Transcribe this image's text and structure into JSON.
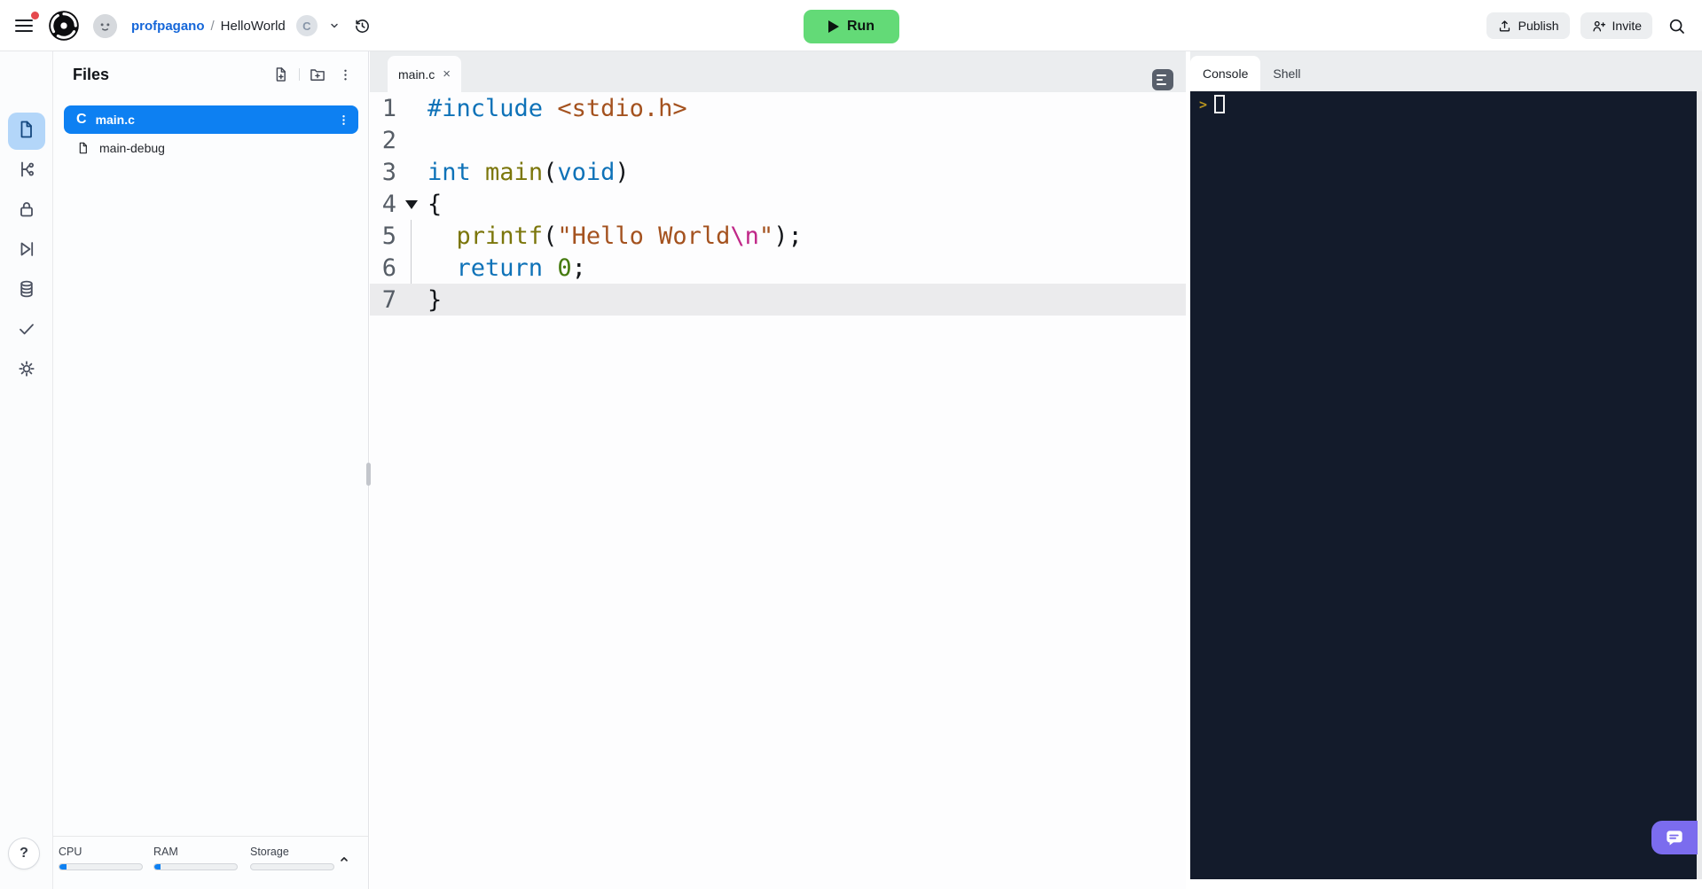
{
  "topbar": {
    "breadcrumb": {
      "user": "profpagano",
      "separator": "/",
      "project": "HelloWorld",
      "language_badge": "C"
    },
    "run_label": "Run",
    "publish_label": "Publish",
    "invite_label": "Invite"
  },
  "rail": {
    "items": [
      {
        "name": "files",
        "icon": "files-icon",
        "selected": true
      },
      {
        "name": "version-control",
        "icon": "branch-icon",
        "selected": false
      },
      {
        "name": "secrets",
        "icon": "lock-icon",
        "selected": false
      },
      {
        "name": "workflows",
        "icon": "runner-icon",
        "selected": false
      },
      {
        "name": "database",
        "icon": "database-icon",
        "selected": false
      },
      {
        "name": "checks",
        "icon": "check-icon",
        "selected": false
      },
      {
        "name": "settings",
        "icon": "gear-icon",
        "selected": false
      }
    ],
    "help_label": "?"
  },
  "files": {
    "title": "Files",
    "items": [
      {
        "name": "main.c",
        "type": "c",
        "selected": true
      },
      {
        "name": "main-debug",
        "type": "file",
        "selected": false
      }
    ]
  },
  "editor": {
    "tab": {
      "label": "main.c",
      "close_glyph": "×"
    },
    "code": {
      "lines": [
        {
          "n": "1",
          "tokens": [
            {
              "t": "#include",
              "c": "kw"
            },
            {
              "t": " ",
              "c": "pl"
            },
            {
              "t": "<stdio.h>",
              "c": "str"
            }
          ]
        },
        {
          "n": "2",
          "tokens": []
        },
        {
          "n": "3",
          "tokens": [
            {
              "t": "int",
              "c": "kw"
            },
            {
              "t": " ",
              "c": "pl"
            },
            {
              "t": "main",
              "c": "fn"
            },
            {
              "t": "(",
              "c": "pl"
            },
            {
              "t": "void",
              "c": "kw"
            },
            {
              "t": ")",
              "c": "pl"
            }
          ]
        },
        {
          "n": "4",
          "fold": true,
          "tokens": [
            {
              "t": "{",
              "c": "pl"
            }
          ]
        },
        {
          "n": "5",
          "guide": true,
          "tokens": [
            {
              "t": "  ",
              "c": "pl"
            },
            {
              "t": "printf",
              "c": "fn"
            },
            {
              "t": "(",
              "c": "pl"
            },
            {
              "t": "\"Hello World",
              "c": "str"
            },
            {
              "t": "\\n",
              "c": "esc"
            },
            {
              "t": "\"",
              "c": "str"
            },
            {
              "t": ");",
              "c": "pl"
            }
          ]
        },
        {
          "n": "6",
          "guide": true,
          "tokens": [
            {
              "t": "  ",
              "c": "pl"
            },
            {
              "t": "return",
              "c": "kw"
            },
            {
              "t": " ",
              "c": "pl"
            },
            {
              "t": "0",
              "c": "num"
            },
            {
              "t": ";",
              "c": "pl"
            }
          ]
        },
        {
          "n": "7",
          "current": true,
          "tokens": [
            {
              "t": "}",
              "c": "pl"
            }
          ]
        }
      ]
    }
  },
  "console": {
    "tabs": [
      {
        "label": "Console",
        "active": true
      },
      {
        "label": "Shell",
        "active": false
      }
    ],
    "prompt_glyph": ">"
  },
  "resources": {
    "meters": [
      {
        "label": "CPU",
        "fill_pct": 9
      },
      {
        "label": "RAM",
        "fill_pct": 7
      },
      {
        "label": "Storage",
        "fill_pct": 0
      }
    ]
  },
  "colors": {
    "accent_blue": "#0d80f2",
    "run_green": "#63da77",
    "chat_purple": "#7b6cee",
    "console_bg": "#131b2b",
    "selected_rail_bg": "#b3d6f9",
    "syntax": {
      "keyword": "#0e72b8",
      "string": "#a4521f",
      "escape": "#c02888",
      "function": "#7b760b",
      "number": "#457a0e",
      "plain": "#14171b"
    }
  }
}
